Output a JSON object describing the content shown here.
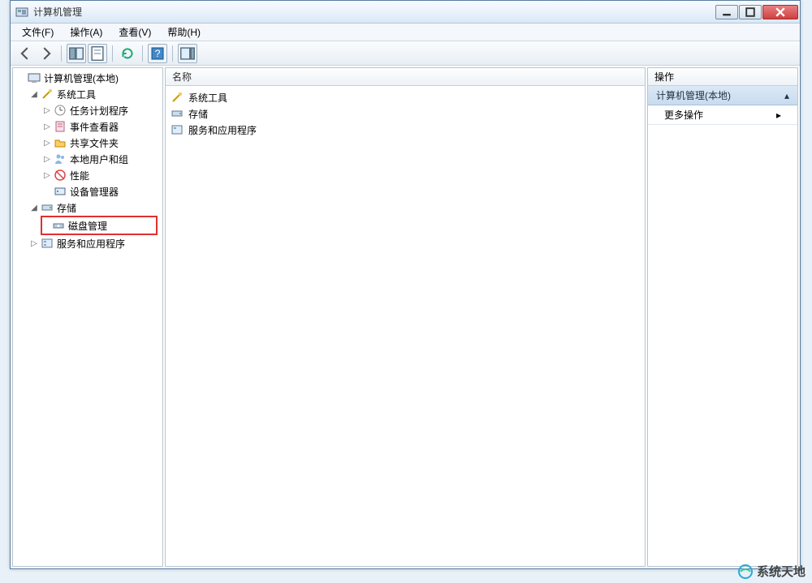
{
  "window": {
    "title": "计算机管理"
  },
  "menu": {
    "file": "文件(F)",
    "action": "操作(A)",
    "view": "查看(V)",
    "help": "帮助(H)"
  },
  "tree": {
    "root": "计算机管理(本地)",
    "system_tools": "系统工具",
    "task_scheduler": "任务计划程序",
    "event_viewer": "事件查看器",
    "shared_folders": "共享文件夹",
    "local_users": "本地用户和组",
    "performance": "性能",
    "device_manager": "设备管理器",
    "storage": "存储",
    "disk_management": "磁盘管理",
    "services_apps": "服务和应用程序"
  },
  "list": {
    "header": "名称",
    "items": {
      "system_tools": "系统工具",
      "storage": "存储",
      "services_apps": "服务和应用程序"
    }
  },
  "actions": {
    "header": "操作",
    "group": "计算机管理(本地)",
    "more": "更多操作"
  },
  "watermark": "系统天地"
}
